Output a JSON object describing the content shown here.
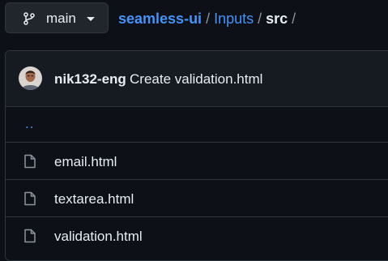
{
  "branch": {
    "name": "main",
    "icon": "git-branch-icon"
  },
  "breadcrumb": {
    "repo": "seamless-ui",
    "folder": "Inputs",
    "current": "src",
    "separator": "/"
  },
  "commit": {
    "author": "nik132-eng",
    "message": "Create validation.html",
    "avatar_icon": "avatar"
  },
  "parent_dir": "..",
  "files": [
    {
      "name": "email.html",
      "icon": "file-icon"
    },
    {
      "name": "textarea.html",
      "icon": "file-icon"
    },
    {
      "name": "validation.html",
      "icon": "file-icon"
    }
  ],
  "colors": {
    "background": "#0d1117",
    "link": "#4493f8",
    "border": "#30363d",
    "text": "#e6edf3"
  }
}
